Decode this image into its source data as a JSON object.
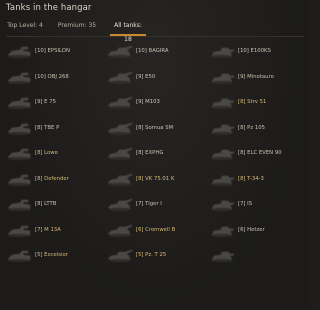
{
  "window": {
    "title": "Tanks in the hangar"
  },
  "tabs": [
    {
      "label": "Top Level: 4"
    },
    {
      "label": "Premium: 35"
    },
    {
      "label": "All tanks: 18"
    }
  ],
  "vehicles": [
    {
      "label": "[10] EPSILON",
      "color": "#c9c3b5"
    },
    {
      "label": "[10] BAGIRA",
      "color": "#c9c3b5"
    },
    {
      "label": "[10] E100KS",
      "color": "#c9c3b5"
    },
    {
      "label": "[10] OBJ 268",
      "color": "#c9c3b5"
    },
    {
      "label": "[9] E50",
      "color": "#c9c3b5"
    },
    {
      "label": "[9] Minotauro",
      "color": "#c9c3b5"
    },
    {
      "label": "[9] E 75",
      "color": "#c9c3b5"
    },
    {
      "label": "[9] M103",
      "color": "#c9c3b5"
    },
    {
      "label": "[8] Strv 51",
      "color": "#d8bb76"
    },
    {
      "label": "[8] TBE P",
      "color": "#c9c3b5"
    },
    {
      "label": "[8] Somua SM",
      "color": "#c9c3b5"
    },
    {
      "label": "[8] Pz 105",
      "color": "#c9c3b5"
    },
    {
      "label": "[8] Lowe",
      "color": "#d8bb76"
    },
    {
      "label": "[8] EXPHG",
      "color": "#c9c3b5"
    },
    {
      "label": "[8] ELC EVEN 90",
      "color": "#c9c3b5"
    },
    {
      "label": "[8] Defender",
      "color": "#d8bb76"
    },
    {
      "label": "[8] VK 75.01 K",
      "color": "#d8bb76"
    },
    {
      "label": "[8] T-34-3",
      "color": "#d8bb76"
    },
    {
      "label": "[8] LTTB",
      "color": "#c9c3b5"
    },
    {
      "label": "[7] Tiger I",
      "color": "#c9c3b5"
    },
    {
      "label": "[7] IS",
      "color": "#c9c3b5"
    },
    {
      "label": "[7] M 13A",
      "color": "#d8bb76"
    },
    {
      "label": "[6] Cromwell B",
      "color": "#d8bb76"
    },
    {
      "label": "[6] Hetzer",
      "color": "#c9c3b5"
    },
    {
      "label": "[5] Excelsior",
      "color": "#d8bb76"
    },
    {
      "label": "[5] Pz. T 25",
      "color": "#d8bb76"
    },
    {
      "label": "",
      "color": "#c9c3b5"
    }
  ],
  "icons": {
    "vehicle": "tank-silhouette-icon"
  }
}
